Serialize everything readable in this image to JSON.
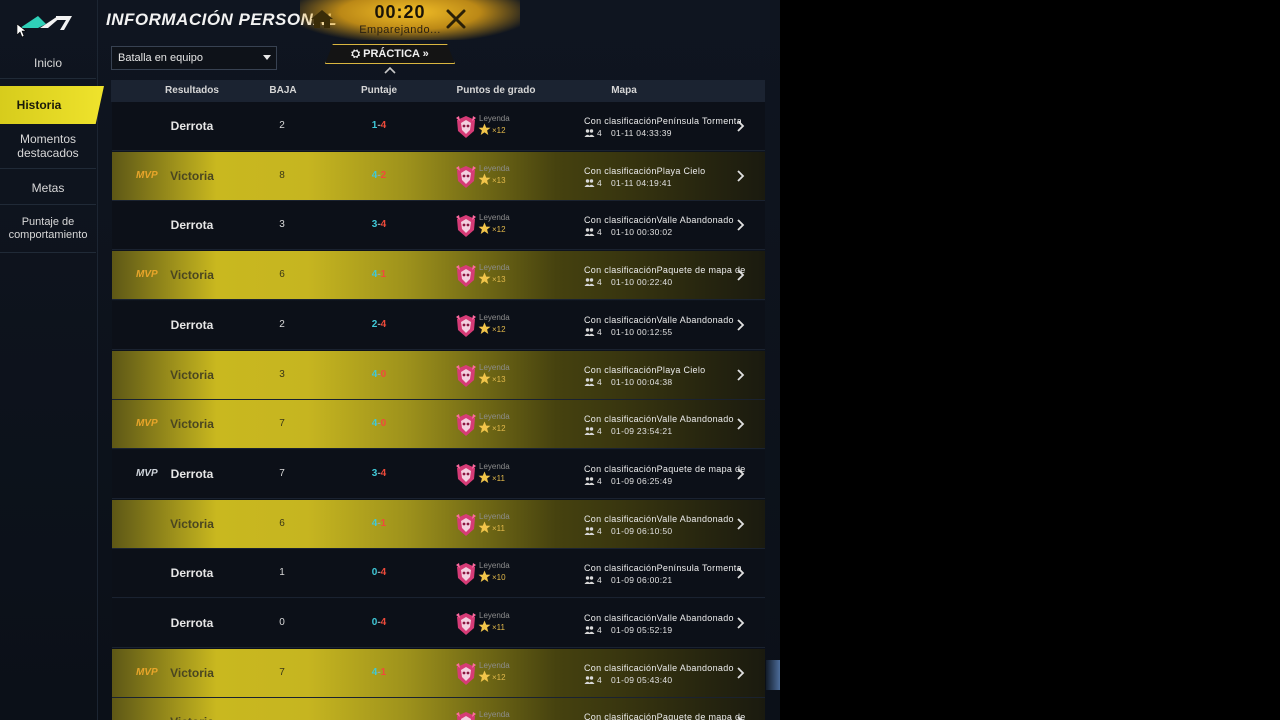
{
  "header": {
    "title": "INFORMACIÓN PERSONAL"
  },
  "matchmaking": {
    "timer": "00:20",
    "status": "Emparejando...",
    "practice_label": "PRÁCTICA"
  },
  "sidebar": {
    "items": [
      {
        "label": "Inicio"
      },
      {
        "label": "Historia",
        "active": true
      },
      {
        "label": "Momentos destacados"
      },
      {
        "label": "Metas"
      },
      {
        "label": "Puntaje de comportamiento"
      }
    ]
  },
  "filter": {
    "mode_value": "Batalla en equipo"
  },
  "table": {
    "headers": {
      "result": "Resultados",
      "kills": "BAJA",
      "score": "Puntaje",
      "rank_points": "Puntos de grado",
      "map": "Mapa"
    },
    "rows": [
      {
        "result": "Derrota",
        "win": false,
        "mvp": false,
        "kills": "2",
        "score_a": "1",
        "score_b": "4",
        "rank": "Leyenda",
        "stars": "×12",
        "map_line": "Con clasificaciónPenínsula Tormenta",
        "players": "4",
        "datetime": "01-11 04:33:39"
      },
      {
        "result": "Victoria",
        "win": true,
        "mvp": true,
        "kills": "8",
        "score_a": "4",
        "score_b": "2",
        "rank": "Leyenda",
        "stars": "×13",
        "map_line": "Con clasificaciónPlaya Cielo",
        "players": "4",
        "datetime": "01-11 04:19:41"
      },
      {
        "result": "Derrota",
        "win": false,
        "mvp": false,
        "kills": "3",
        "score_a": "3",
        "score_b": "4",
        "rank": "Leyenda",
        "stars": "×12",
        "map_line": "Con clasificaciónValle Abandonado",
        "players": "4",
        "datetime": "01-10 00:30:02"
      },
      {
        "result": "Victoria",
        "win": true,
        "mvp": true,
        "kills": "6",
        "score_a": "4",
        "score_b": "1",
        "rank": "Leyenda",
        "stars": "×13",
        "map_line": "Con clasificaciónPaquete de mapa de",
        "players": "4",
        "datetime": "01-10 00:22:40"
      },
      {
        "result": "Derrota",
        "win": false,
        "mvp": false,
        "kills": "2",
        "score_a": "2",
        "score_b": "4",
        "rank": "Leyenda",
        "stars": "×12",
        "map_line": "Con clasificaciónValle Abandonado",
        "players": "4",
        "datetime": "01-10 00:12:55"
      },
      {
        "result": "Victoria",
        "win": true,
        "mvp": false,
        "kills": "3",
        "score_a": "4",
        "score_b": "0",
        "rank": "Leyenda",
        "stars": "×13",
        "map_line": "Con clasificaciónPlaya Cielo",
        "players": "4",
        "datetime": "01-10 00:04:38"
      },
      {
        "result": "Victoria",
        "win": true,
        "mvp": true,
        "kills": "7",
        "score_a": "4",
        "score_b": "0",
        "rank": "Leyenda",
        "stars": "×12",
        "map_line": "Con clasificaciónValle Abandonado",
        "players": "4",
        "datetime": "01-09 23:54:21"
      },
      {
        "result": "Derrota",
        "win": false,
        "mvp": true,
        "kills": "7",
        "score_a": "3",
        "score_b": "4",
        "rank": "Leyenda",
        "stars": "×11",
        "map_line": "Con clasificaciónPaquete de mapa de",
        "players": "4",
        "datetime": "01-09 06:25:49"
      },
      {
        "result": "Victoria",
        "win": true,
        "mvp": false,
        "kills": "6",
        "score_a": "4",
        "score_b": "1",
        "rank": "Leyenda",
        "stars": "×11",
        "map_line": "Con clasificaciónValle Abandonado",
        "players": "4",
        "datetime": "01-09 06:10:50"
      },
      {
        "result": "Derrota",
        "win": false,
        "mvp": false,
        "kills": "1",
        "score_a": "0",
        "score_b": "4",
        "rank": "Leyenda",
        "stars": "×10",
        "map_line": "Con clasificaciónPenínsula Tormenta",
        "players": "4",
        "datetime": "01-09 06:00:21"
      },
      {
        "result": "Derrota",
        "win": false,
        "mvp": false,
        "kills": "0",
        "score_a": "0",
        "score_b": "4",
        "rank": "Leyenda",
        "stars": "×11",
        "map_line": "Con clasificaciónValle Abandonado",
        "players": "4",
        "datetime": "01-09 05:52:19"
      },
      {
        "result": "Victoria",
        "win": true,
        "mvp": true,
        "kills": "7",
        "score_a": "4",
        "score_b": "1",
        "rank": "Leyenda",
        "stars": "×12",
        "map_line": "Con clasificaciónValle Abandonado",
        "players": "4",
        "datetime": "01-09 05:43:40"
      },
      {
        "result": "Victoria",
        "win": true,
        "mvp": false,
        "kills": "",
        "score_a": "",
        "score_b": "",
        "rank": "Leyenda",
        "stars": "",
        "map_line": "Con clasificaciónPaquete de mapa de",
        "players": "",
        "datetime": ""
      }
    ],
    "mvp_label": "MVP"
  },
  "colors": {
    "accent_yellow": "#e4d828",
    "win_gold": "#c9b81f",
    "score_cyan": "#3fc9d8",
    "score_red": "#f04a3a",
    "mvp_orange": "#e8a52a"
  },
  "icons": {
    "logo": "game-logo-icon",
    "home": "home-icon",
    "close": "close-icon",
    "practice": "practice-icon",
    "rank": "legend-rank-icon",
    "star": "star-icon",
    "players": "people-icon",
    "row_nav": "chevron-right-icon",
    "collapse": "chevron-up-icon"
  }
}
